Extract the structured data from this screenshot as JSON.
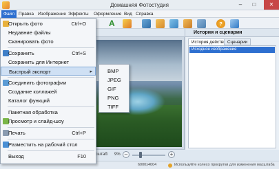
{
  "window": {
    "title": "Домашняя Фотостудия"
  },
  "menubar": [
    "Файл",
    "Правка",
    "Изображение",
    "Эффекты",
    "Оформление",
    "Вид",
    "Справка"
  ],
  "file_menu": {
    "items": [
      {
        "label": "Открыть фото",
        "shortcut": "Ctrl+O",
        "icon": "open-folder-icon"
      },
      {
        "label": "Недавние файлы",
        "shortcut": "",
        "icon": ""
      },
      {
        "label": "Сканировать фото",
        "shortcut": "",
        "icon": ""
      },
      {
        "label": "Сохранить",
        "shortcut": "Ctrl+S",
        "icon": "save-icon"
      },
      {
        "label": "Сохранить для Интернет",
        "shortcut": "",
        "icon": ""
      },
      {
        "label": "Быстрый экспорт",
        "shortcut": "",
        "icon": ""
      },
      {
        "label": "Соединить фотографии",
        "shortcut": "",
        "icon": "merge-photos-icon"
      },
      {
        "label": "Создание коллажей",
        "shortcut": "",
        "icon": ""
      },
      {
        "label": "Каталог функций",
        "shortcut": "",
        "icon": ""
      },
      {
        "label": "Пакетная обработка",
        "shortcut": "",
        "icon": ""
      },
      {
        "label": "Просмотр и слайд-шоу",
        "shortcut": "",
        "icon": "slideshow-icon"
      },
      {
        "label": "Печать",
        "shortcut": "Ctrl+P",
        "icon": "print-icon"
      },
      {
        "label": "Разместить на рабочий стол",
        "shortcut": "",
        "icon": "desktop-icon"
      },
      {
        "label": "Выход",
        "shortcut": "F10",
        "icon": ""
      }
    ]
  },
  "export_submenu": [
    "BMP",
    "JPEG",
    "GIF",
    "PNG",
    "TIFF"
  ],
  "right_panel": {
    "header": "История и сценарии",
    "tabs": [
      "История действий",
      "Сценарии"
    ],
    "history_items": [
      "Исходное изображение"
    ]
  },
  "zoom": {
    "label": "Масштаб:",
    "value": "9%"
  },
  "status": {
    "dimensions": "6000x4004",
    "hint": "Используйте колесо прокрутки для изменения масштаба"
  },
  "colors": {
    "menu_highlight": "#cfe0f4",
    "selection": "#2d6fd0"
  }
}
